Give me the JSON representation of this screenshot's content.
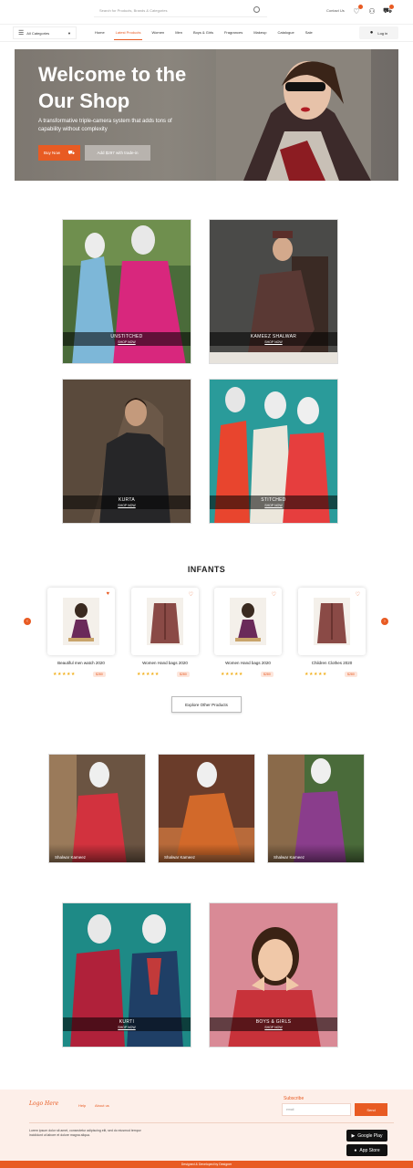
{
  "header": {
    "search_placeholder": "Search for Products, Brands & Categories",
    "contact_label": "Contact Us"
  },
  "nav": {
    "category_select": "All Categories",
    "links": [
      "Home",
      "Latest Products",
      "Women",
      "Men",
      "Boys & Girls",
      "Fragrances",
      "Makeup",
      "Catalogue",
      "Sale"
    ],
    "active_index": 1,
    "login_label": "Log in"
  },
  "hero": {
    "title_line1": "Welcome to the",
    "title_line2": "Our Shop",
    "subtitle": "A transformative triple-camera system that adds tons of capability without complexity",
    "buy_now": "Buy Now",
    "price_btn": "Add $297 with trade-in"
  },
  "categories": [
    {
      "title": "UNSTITCHED",
      "link": "SHOP NOW"
    },
    {
      "title": "KAMEEZ SHALWAR",
      "link": "SHOP NOW"
    },
    {
      "title": "KURTA",
      "link": "SHOP NOW"
    },
    {
      "title": "STITCHED",
      "link": "SHOP NOW"
    }
  ],
  "infants": {
    "title": "INFANTS",
    "products": [
      {
        "name": "Beautiful men watch 2020",
        "price": "$280",
        "stars": "★★★★★"
      },
      {
        "name": "Women Hand bags 2020",
        "price": "$280",
        "stars": "★★★★★"
      },
      {
        "name": "Women Hand bags 2020",
        "price": "$280",
        "stars": "★★★★★"
      },
      {
        "name": "Children Clothes 2020",
        "price": "$280",
        "stars": "★★★★★"
      }
    ],
    "explore_label": "Explore Other Products"
  },
  "shalwar": [
    {
      "label": "Shalwar Kameez"
    },
    {
      "label": "Shalwar Kameez"
    },
    {
      "label": "Shalwar Kameez"
    }
  ],
  "bottom_cards": [
    {
      "title": "KURTI",
      "link": "SHOP NOW"
    },
    {
      "title": "BOYS & GIRLS",
      "link": "SHOP NOW"
    }
  ],
  "footer": {
    "logo": "Logo Here",
    "links": [
      "Help",
      "About us"
    ],
    "subscribe_title": "Subscribe",
    "email_placeholder": "email",
    "send_label": "Send",
    "description": "Lorem ipsum dolor sit amet, consectetur adipiscing elit, sed do eiusmod tempor incididunt ut labore et dolore magna aliqua.",
    "google_play": "Google Play",
    "app_store": "App Store",
    "copyright": "Designed & Developed by Designer"
  },
  "colors": {
    "accent": "#e85b23"
  }
}
